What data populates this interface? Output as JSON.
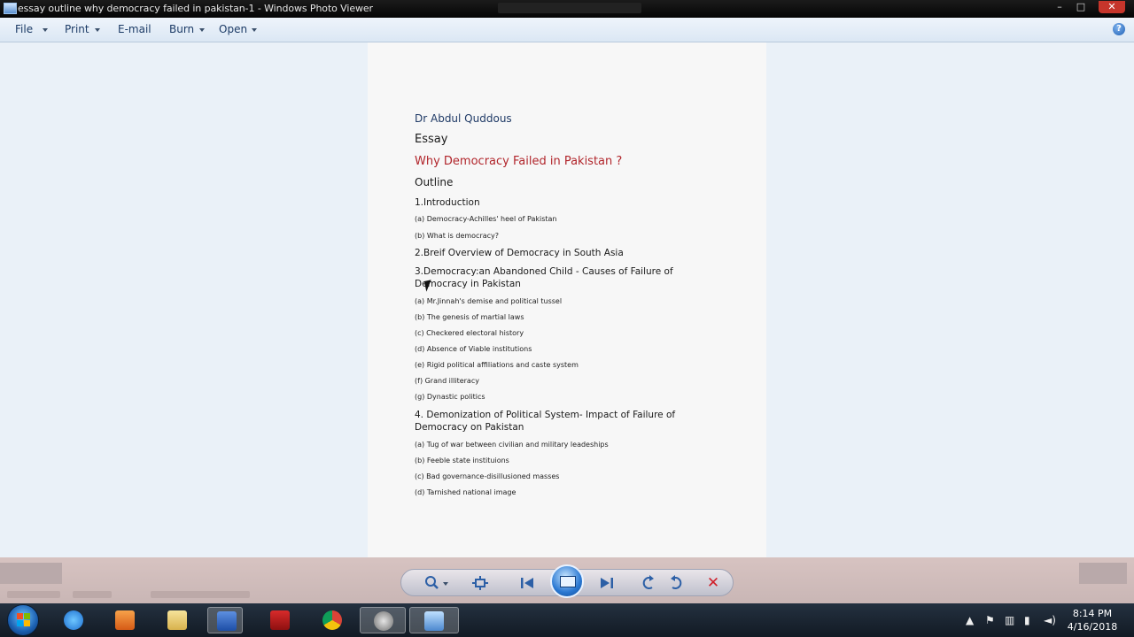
{
  "window": {
    "title": "essay outline why democracy failed in pakistan-1 - Windows Photo Viewer",
    "controls": {
      "minimize": "–",
      "maximize": "□",
      "close": "✕"
    }
  },
  "menubar": {
    "items": [
      {
        "label": "File",
        "has_dropdown": true
      },
      {
        "label": "Print",
        "has_dropdown": true
      },
      {
        "label": "E-mail",
        "has_dropdown": false
      },
      {
        "label": "Burn",
        "has_dropdown": true
      },
      {
        "label": "Open",
        "has_dropdown": true
      }
    ],
    "help_label": "?"
  },
  "document": {
    "author": "Dr Abdul Quddous",
    "type": "Essay",
    "title": "Why Democracy Failed in Pakistan ?",
    "outline_heading": "Outline",
    "sections": [
      {
        "heading": "1.Introduction",
        "items": [
          "(a) Democracy-Achilles' heel of Pakistan",
          "(b) What is democracy?"
        ]
      },
      {
        "heading": "2.Breif Overview of Democracy in South Asia",
        "items": []
      },
      {
        "heading": "3.Democracy:an Abandoned Child - Causes of Failure of Democracy in Pakistan",
        "items": [
          "(a) Mr.Jinnah's demise and political tussel",
          "(b) The genesis of martial laws",
          "(c) Checkered electoral history",
          "(d) Absence of Viable institutions",
          "(e) Rigid political affiliations and caste system",
          "(f) Grand illiteracy",
          "(g) Dynastic politics"
        ]
      },
      {
        "heading": "4. Demonization of Political System- Impact of Failure of Democracy on Pakistan",
        "items": [
          "(a) Tug of war between civilian and military leadeships",
          "(b) Feeble state instituions",
          "(c) Bad governance-disillusioned masses",
          "(d) Tarnished national image"
        ]
      }
    ]
  },
  "toolbar": {
    "zoom_icon": "magnifier-icon",
    "fit_icon": "actual-size-icon",
    "prev_icon": "previous-icon",
    "slideshow_icon": "slideshow-icon",
    "next_icon": "next-icon",
    "rotate_ccw_icon": "rotate-counterclockwise-icon",
    "rotate_cw_icon": "rotate-clockwise-icon",
    "delete_icon": "delete-icon"
  },
  "taskbar": {
    "pinned": [
      "ie-icon",
      "media-player-icon",
      "explorer-icon",
      "word-icon",
      "acrobat-icon",
      "chrome-icon",
      "camera-icon",
      "photo-viewer-icon"
    ],
    "tray_icons": [
      "show-hidden-icon",
      "action-center-icon",
      "network-icon",
      "volume-icon"
    ],
    "clock": {
      "time": "8:14 PM",
      "date": "4/16/2018"
    }
  }
}
